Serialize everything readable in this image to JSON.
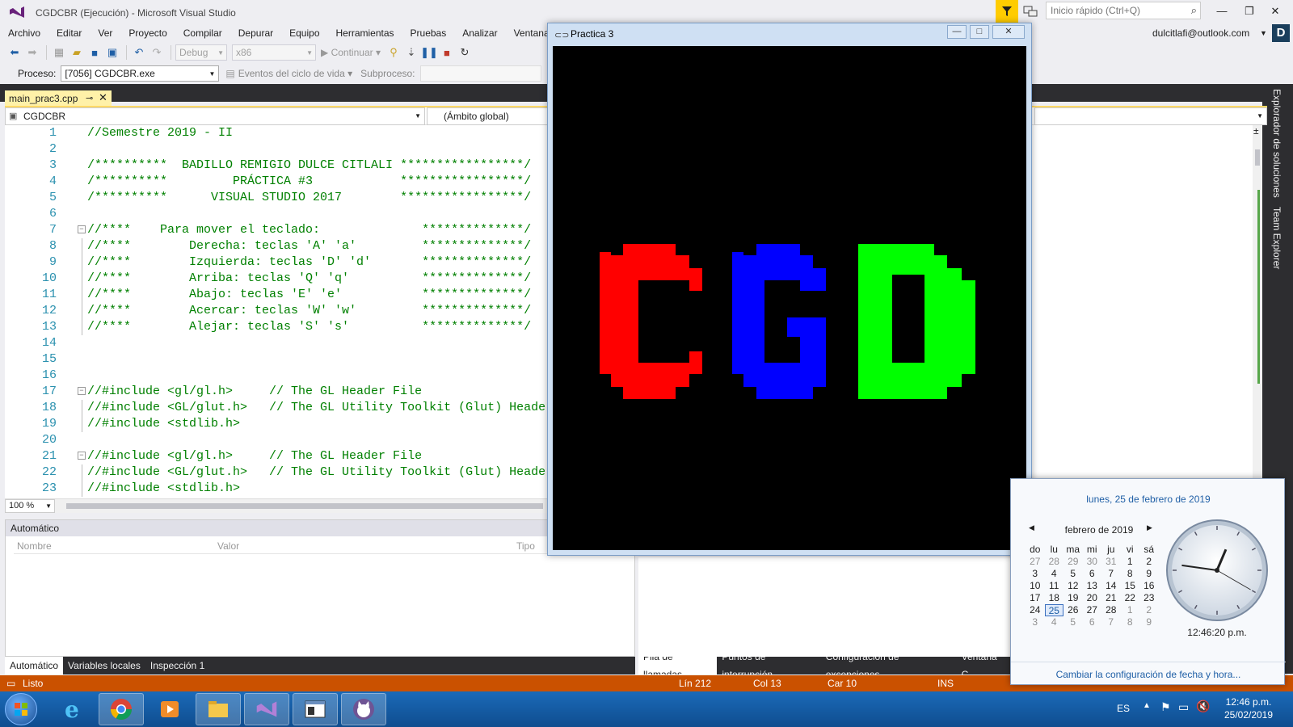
{
  "window": {
    "title": "CGDCBR (Ejecución) - Microsoft Visual Studio",
    "quick_launch_placeholder": "Inicio rápido (Ctrl+Q)",
    "account": "dulcitlafi@outlook.com",
    "avatar_letter": "D"
  },
  "menu": [
    "Archivo",
    "Editar",
    "Ver",
    "Proyecto",
    "Compilar",
    "Depurar",
    "Equipo",
    "Herramientas",
    "Pruebas",
    "Analizar",
    "Ventana"
  ],
  "toolbar": {
    "config": "Debug",
    "platform": "x86",
    "continue_label": "Continuar"
  },
  "process_bar": {
    "process_label": "Proceso:",
    "process_value": "[7056] CGDCBR.exe",
    "lifecycle_label": "Eventos del ciclo de vida",
    "thread_label": "Subproceso:"
  },
  "editor": {
    "tab_name": "main_prac3.cpp",
    "nav_project": "CGDCBR",
    "nav_scope": "(Ámbito global)",
    "zoom": "100 %",
    "lines": [
      {
        "n": "1",
        "t": "//Semestre 2019 - II"
      },
      {
        "n": "2",
        "t": ""
      },
      {
        "n": "3",
        "t": "/**********  BADILLO REMIGIO DULCE CITLALI *****************/"
      },
      {
        "n": "4",
        "t": "/**********         PRÁCTICA #3            *****************/"
      },
      {
        "n": "5",
        "t": "/**********      VISUAL STUDIO 2017        *****************/"
      },
      {
        "n": "6",
        "t": ""
      },
      {
        "n": "7",
        "t": "//****    Para mover el teclado:              **************/"
      },
      {
        "n": "8",
        "t": "//****        Derecha: teclas 'A' 'a'         **************/"
      },
      {
        "n": "9",
        "t": "//****        Izquierda: teclas 'D' 'd'       **************/"
      },
      {
        "n": "10",
        "t": "//****        Arriba: teclas 'Q' 'q'          **************/"
      },
      {
        "n": "11",
        "t": "//****        Abajo: teclas 'E' 'e'           **************/"
      },
      {
        "n": "12",
        "t": "//****        Acercar: teclas 'W' 'w'         **************/"
      },
      {
        "n": "13",
        "t": "//****        Alejar: teclas 'S' 's'          **************/"
      },
      {
        "n": "14",
        "t": ""
      },
      {
        "n": "15",
        "t": ""
      },
      {
        "n": "16",
        "t": ""
      },
      {
        "n": "17",
        "t": "//#include <gl/gl.h>     // The GL Header File"
      },
      {
        "n": "18",
        "t": "//#include <GL/glut.h>   // The GL Utility Toolkit (Glut) Header"
      },
      {
        "n": "19",
        "t": "//#include <stdlib.h>"
      },
      {
        "n": "20",
        "t": ""
      },
      {
        "n": "21",
        "t": "//#include <gl/gl.h>     // The GL Header File"
      },
      {
        "n": "22",
        "t": "//#include <GL/glut.h>   // The GL Utility Toolkit (Glut) Header"
      },
      {
        "n": "23",
        "t": "//#include <stdlib.h>"
      }
    ]
  },
  "autos_pane": {
    "title": "Automático",
    "col_name": "Nombre",
    "col_value": "Valor",
    "col_type": "Tipo",
    "tabs": [
      "Automático",
      "Variables locales",
      "Inspección 1"
    ]
  },
  "right_bottom_tabs": [
    "Pila de llamadas",
    "Puntos de interrupción",
    "Configuración de excepciones",
    "Ventana C"
  ],
  "side_tabs": [
    "Explorador de soluciones",
    "Team Explorer"
  ],
  "status": {
    "state": "Listo",
    "line": "Lín 212",
    "col": "Col 13",
    "car": "Car 10",
    "mode": "INS"
  },
  "practica": {
    "title": "Practica 3",
    "letters": [
      {
        "char": "C",
        "color": "#ff0000"
      },
      {
        "char": "G",
        "color": "#0000ff"
      },
      {
        "char": "D",
        "color": "#00ff00"
      }
    ]
  },
  "calendar": {
    "full_date": "lunes, 25 de febrero de 2019",
    "month": "febrero de 2019",
    "weekdays": [
      "do",
      "lu",
      "ma",
      "mi",
      "ju",
      "vi",
      "sá"
    ],
    "weeks": [
      [
        "27",
        "28",
        "29",
        "30",
        "31",
        "1",
        "2"
      ],
      [
        "3",
        "4",
        "5",
        "6",
        "7",
        "8",
        "9"
      ],
      [
        "10",
        "11",
        "12",
        "13",
        "14",
        "15",
        "16"
      ],
      [
        "17",
        "18",
        "19",
        "20",
        "21",
        "22",
        "23"
      ],
      [
        "24",
        "25",
        "26",
        "27",
        "28",
        "1",
        "2"
      ],
      [
        "3",
        "4",
        "5",
        "6",
        "7",
        "8",
        "9"
      ]
    ],
    "today": "25",
    "time": "12:46:20 p.m.",
    "link": "Cambiar la configuración de fecha y hora..."
  },
  "taskbar": {
    "language": "ES",
    "time": "12:46 p.m.",
    "date": "25/02/2019"
  }
}
